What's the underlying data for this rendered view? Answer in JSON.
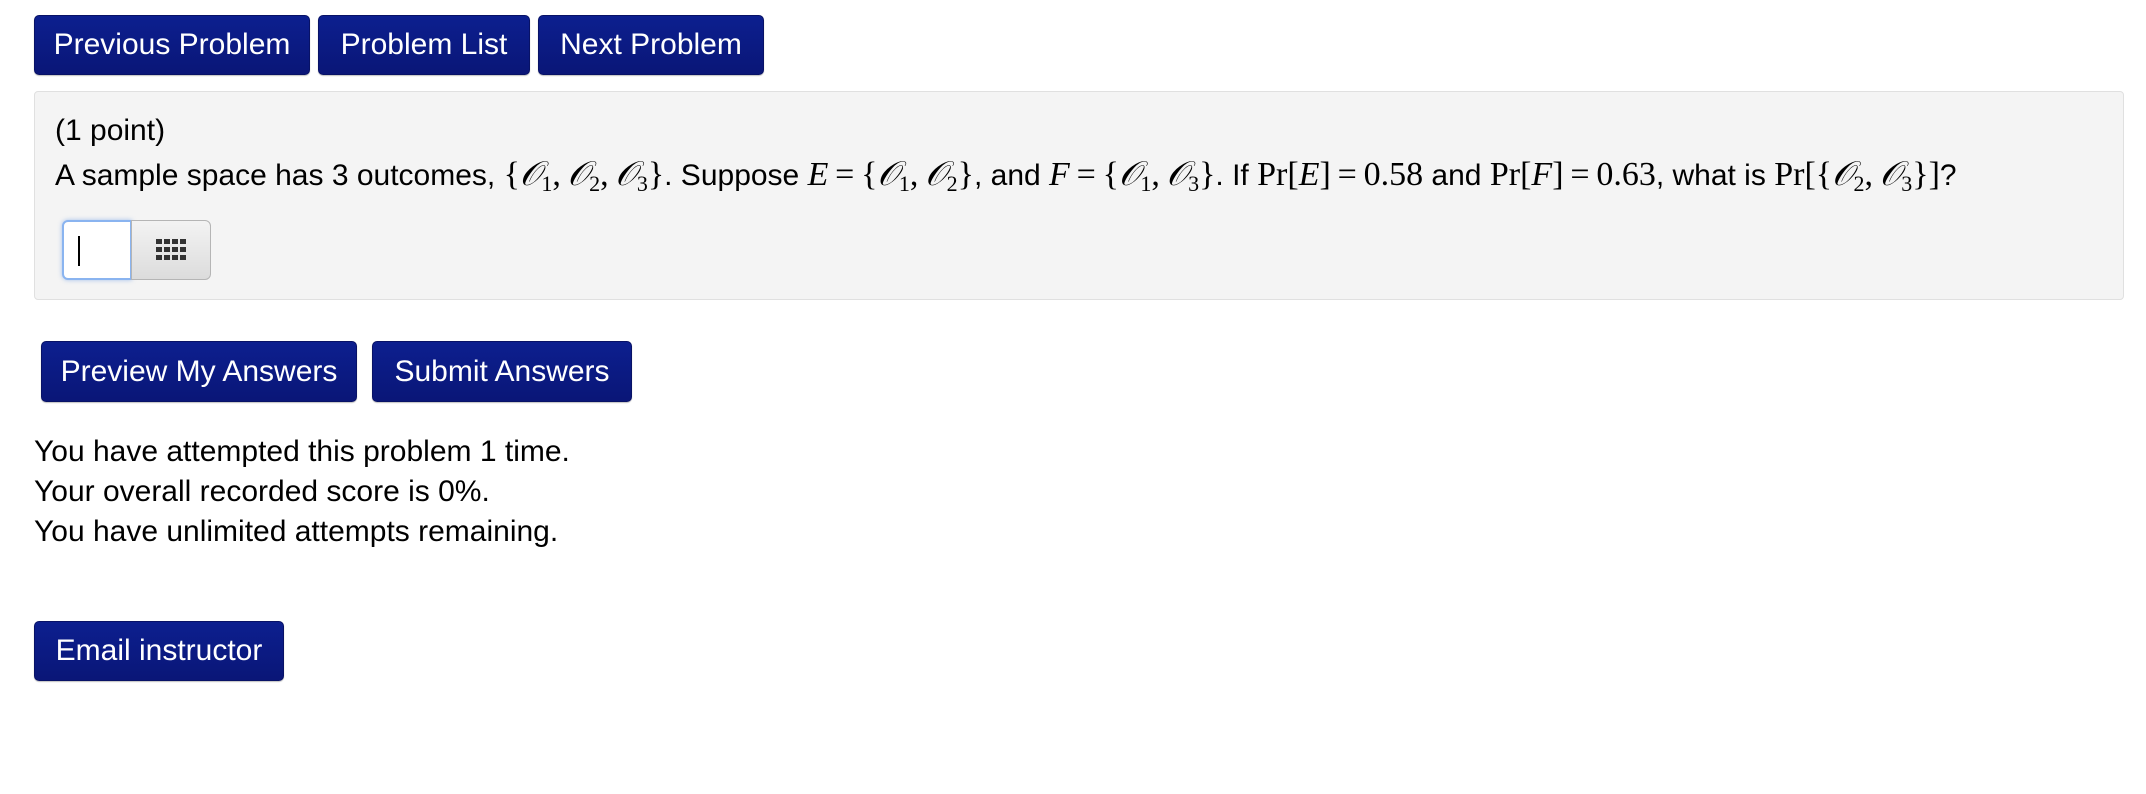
{
  "nav": {
    "previous_label": "Previous Problem",
    "list_label": "Problem List",
    "next_label": "Next Problem"
  },
  "problem": {
    "points": "(1 point)",
    "text_1": "A sample space has 3 outcomes, ",
    "text_2": ". Suppose ",
    "text_3": ", and ",
    "text_4": ". If ",
    "text_5": " and ",
    "text_6": ", what is ",
    "text_7": "?",
    "answer_value": ""
  },
  "math": {
    "set_all": "{𝒪1, 𝒪2, 𝒪3}",
    "E_def": "E = {𝒪1, 𝒪2}",
    "F_def": "F = {𝒪1, 𝒪3}",
    "pr_E": "Pr[E] = 0.58",
    "pr_F": "Pr[F] = 0.63",
    "query": "Pr[{𝒪2, 𝒪3}]"
  },
  "actions": {
    "preview_label": "Preview My Answers",
    "submit_label": "Submit Answers",
    "email_label": "Email instructor"
  },
  "status": {
    "attempts": "You have attempted this problem 1 time.",
    "score": "Your overall recorded score is 0%.",
    "remaining": "You have unlimited attempts remaining."
  },
  "icons": {
    "equation_editor": "grid-icon"
  },
  "colors": {
    "button_bg": "#0a1677",
    "problem_bg": "#f4f4f4",
    "input_focus": "#8ab4f0"
  }
}
